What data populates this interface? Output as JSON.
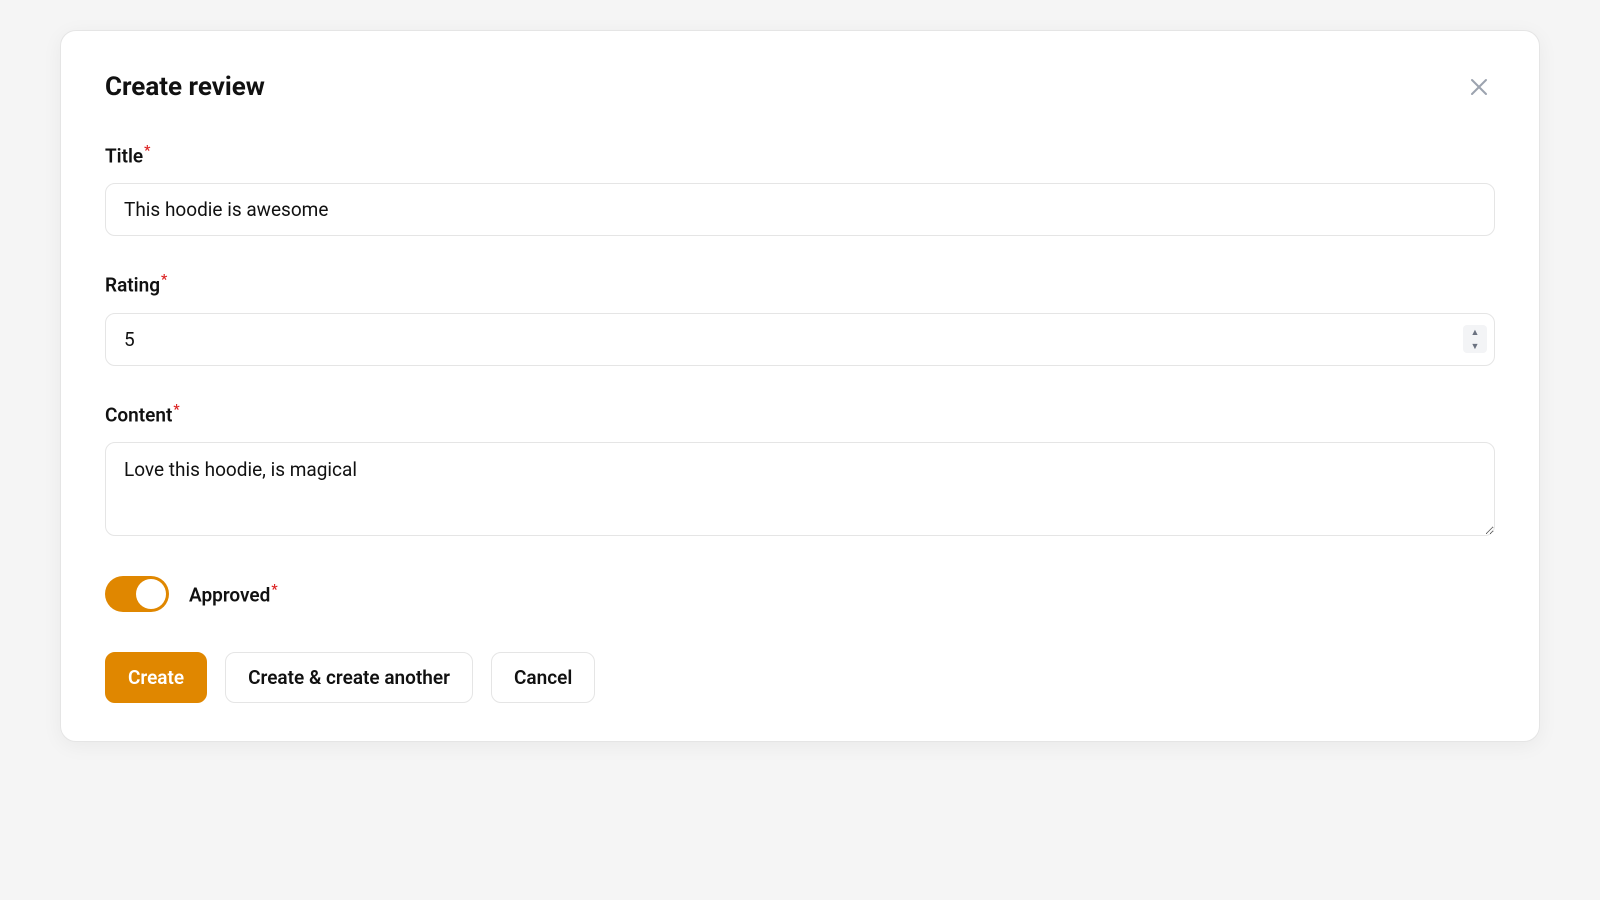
{
  "modal": {
    "title": "Create review"
  },
  "form": {
    "title": {
      "label": "Title",
      "value": "This hoodie is awesome"
    },
    "rating": {
      "label": "Rating",
      "value": "5"
    },
    "content": {
      "label": "Content",
      "value": "Love this hoodie, is magical"
    },
    "approved": {
      "label": "Approved",
      "checked": true
    }
  },
  "actions": {
    "create": "Create",
    "create_another": "Create & create another",
    "cancel": "Cancel"
  },
  "colors": {
    "accent": "#e08700",
    "required": "#dc2626"
  }
}
